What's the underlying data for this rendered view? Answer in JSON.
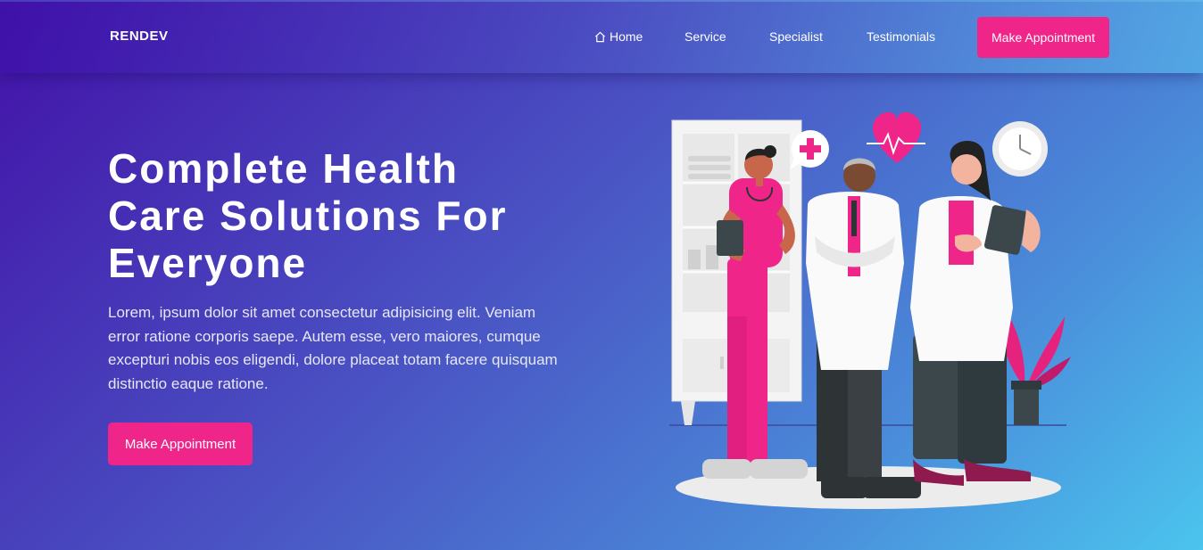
{
  "brand": {
    "name": "RENDEV"
  },
  "nav": {
    "items": [
      {
        "label": "Home",
        "icon": "home-icon"
      },
      {
        "label": "Service"
      },
      {
        "label": "Specialist"
      },
      {
        "label": "Testimonials"
      }
    ],
    "cta_label": "Make Appointment"
  },
  "hero": {
    "title_line1": "Complete Health",
    "title_line2": "Care Solutions For",
    "title_line3": "Everyone",
    "description": "Lorem, ipsum dolor sit amet consectetur adipisicing elit. Veniam error ratione corporis saepe. Autem esse, vero maiores, cumque excepturi nobis eos eligendi, dolore placeat totam facere quisquam distinctio eaque ratione.",
    "cta_label": "Make Appointment",
    "illustration": "three-doctors-illustration"
  },
  "colors": {
    "accent": "#f0258a",
    "gradient_start": "#4311a8",
    "gradient_end": "#4bc4ee"
  }
}
